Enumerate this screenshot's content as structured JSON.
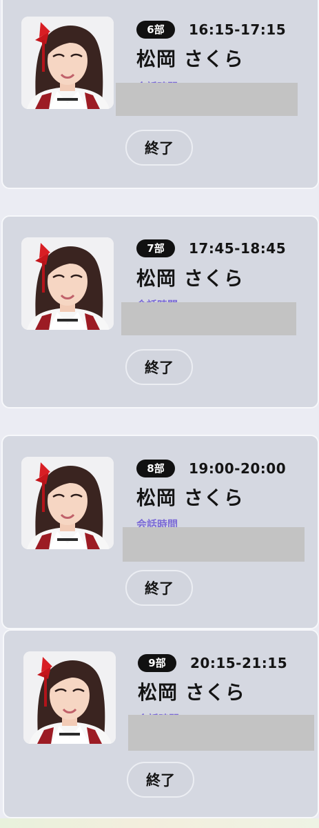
{
  "sessions": [
    {
      "part": "6部",
      "time": "16:15-17:15",
      "member": "松岡 さくら",
      "talk_label": "会話時間",
      "end_label": "終了"
    },
    {
      "part": "7部",
      "time": "17:45-18:45",
      "member": "松岡 さくら",
      "talk_label": "会話時間",
      "end_label": "終了"
    },
    {
      "part": "8部",
      "time": "19:00-20:00",
      "member": "松岡 さくら",
      "talk_label": "会話時間",
      "end_label": "終了"
    },
    {
      "part": "9部",
      "time": "20:15-21:15",
      "member": "松岡 さくら",
      "talk_label": "会話時間",
      "end_label": "終了"
    }
  ],
  "colors": {
    "card_bg": "#d5d8e1",
    "badge_bg": "#111111",
    "talk_link": "#7b6ad6",
    "redaction": "#c3c3c3"
  }
}
